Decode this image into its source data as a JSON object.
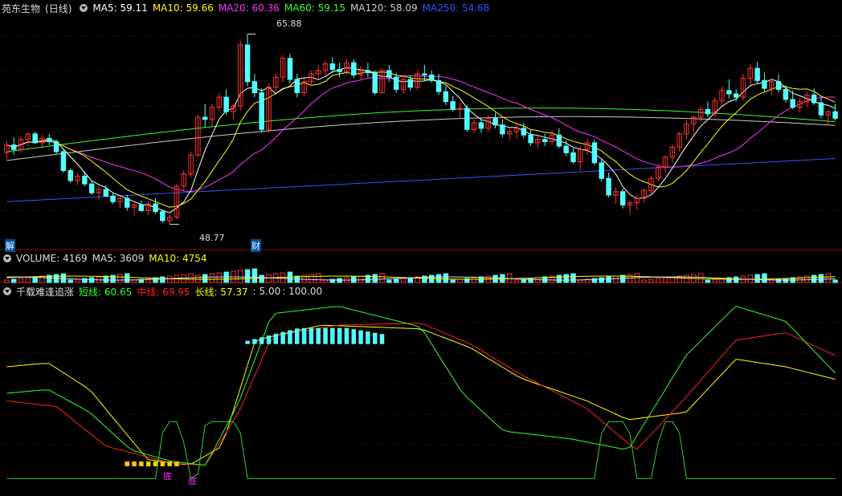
{
  "stock": {
    "name": "苑东生物",
    "period": "(日线)"
  },
  "ma_legend": [
    {
      "label": "MA5: 59.11",
      "color": "#ffffff"
    },
    {
      "label": "MA10: 59.66",
      "color": "#ffff00"
    },
    {
      "label": "MA20: 60.36",
      "color": "#ff33ff"
    },
    {
      "label": "MA60: 59.15",
      "color": "#33ff33"
    },
    {
      "label": "MA120: 58.09",
      "color": "#cccccc"
    },
    {
      "label": "MA250: 54.68",
      "color": "#3355ff"
    }
  ],
  "vol_legend": [
    {
      "label": "VOLUME: 4169",
      "color": "#dddddd"
    },
    {
      "label": "MA5: 3609",
      "color": "#dddddd"
    },
    {
      "label": "MA10: 4754",
      "color": "#ffff00"
    }
  ],
  "ind_legend": [
    {
      "label": "千载难逢追涨",
      "color": "#dddddd"
    },
    {
      "label": "短线: 60.65",
      "color": "#33ff33"
    },
    {
      "label": "中线: 69.95",
      "color": "#ff2222"
    },
    {
      "label": "长线: 57.37",
      "color": "#ffff00"
    },
    {
      "label": ": 5.00",
      "color": "#dddddd"
    },
    {
      "label": ": 100.00",
      "color": "#dddddd"
    }
  ],
  "annotations": {
    "high": "65.88",
    "low": "48.77",
    "jie": "解",
    "cai": "财",
    "di": "底"
  },
  "colors": {
    "up": "#ff3333",
    "down": "#54ffff",
    "ma5": "#ffffff",
    "ma10": "#ffff00",
    "ma20": "#ff33ff",
    "ma60": "#33ff33",
    "ma120": "#cccccc",
    "ma250": "#3355ff",
    "grid": "#7a0000"
  },
  "chart_data": {
    "type": "candlestick",
    "price_ylim": [
      47.5,
      67.5
    ],
    "candles": [
      [
        55.2,
        56.3,
        54.6,
        55.9
      ],
      [
        55.9,
        56.6,
        55.0,
        55.5
      ],
      [
        55.5,
        56.7,
        55.2,
        56.4
      ],
      [
        56.4,
        57.0,
        55.8,
        56.9
      ],
      [
        56.9,
        57.1,
        56.0,
        56.1
      ],
      [
        56.1,
        56.8,
        55.6,
        56.5
      ],
      [
        56.5,
        56.9,
        55.9,
        56.2
      ],
      [
        56.2,
        56.4,
        55.1,
        55.3
      ],
      [
        55.3,
        55.6,
        53.4,
        53.6
      ],
      [
        53.6,
        53.8,
        52.5,
        52.7
      ],
      [
        52.7,
        53.4,
        52.3,
        53.1
      ],
      [
        53.1,
        53.5,
        52.2,
        52.4
      ],
      [
        52.4,
        52.7,
        51.4,
        51.6
      ],
      [
        51.6,
        52.2,
        51.0,
        51.9
      ],
      [
        51.9,
        52.3,
        51.2,
        51.3
      ],
      [
        51.3,
        51.6,
        50.6,
        50.8
      ],
      [
        50.8,
        51.3,
        50.2,
        51.1
      ],
      [
        51.1,
        51.4,
        50.0,
        50.3
      ],
      [
        50.3,
        50.7,
        49.6,
        50.5
      ],
      [
        50.5,
        50.9,
        49.9,
        50.0
      ],
      [
        50.0,
        50.8,
        49.6,
        50.6
      ],
      [
        50.6,
        51.1,
        49.7,
        49.9
      ],
      [
        49.9,
        50.1,
        48.9,
        49.1
      ],
      [
        49.1,
        49.6,
        48.8,
        49.4
      ],
      [
        49.4,
        52.4,
        49.2,
        52.2
      ],
      [
        52.2,
        53.6,
        51.8,
        53.3
      ],
      [
        53.3,
        55.3,
        53.0,
        55.0
      ],
      [
        55.0,
        58.6,
        54.8,
        58.4
      ],
      [
        58.4,
        59.6,
        57.5,
        58.2
      ],
      [
        58.2,
        59.6,
        57.6,
        59.3
      ],
      [
        59.3,
        60.6,
        58.9,
        60.2
      ],
      [
        60.2,
        60.9,
        58.6,
        58.9
      ],
      [
        58.9,
        59.6,
        58.2,
        59.4
      ],
      [
        59.4,
        65.3,
        59.0,
        64.9
      ],
      [
        64.9,
        65.88,
        61.2,
        61.6
      ],
      [
        61.6,
        62.3,
        60.2,
        60.6
      ],
      [
        60.6,
        61.0,
        57.0,
        57.3
      ],
      [
        57.3,
        61.4,
        57.0,
        61.1
      ],
      [
        61.1,
        62.4,
        60.7,
        62.0
      ],
      [
        62.0,
        64.0,
        61.5,
        63.7
      ],
      [
        63.7,
        64.1,
        61.5,
        61.8
      ],
      [
        61.8,
        62.3,
        60.2,
        60.6
      ],
      [
        60.6,
        61.9,
        60.3,
        61.6
      ],
      [
        61.6,
        62.6,
        61.2,
        62.3
      ],
      [
        62.3,
        63.1,
        61.9,
        62.6
      ],
      [
        62.6,
        63.5,
        62.2,
        63.2
      ],
      [
        63.2,
        63.8,
        62.4,
        62.7
      ],
      [
        62.7,
        63.3,
        62.0,
        62.5
      ],
      [
        62.5,
        63.7,
        62.2,
        63.3
      ],
      [
        63.3,
        63.6,
        61.9,
        62.2
      ],
      [
        62.2,
        63.0,
        61.7,
        62.6
      ],
      [
        62.6,
        63.3,
        62.0,
        62.4
      ],
      [
        62.4,
        62.6,
        60.4,
        60.6
      ],
      [
        60.6,
        62.8,
        60.5,
        62.6
      ],
      [
        62.6,
        63.1,
        61.6,
        62.0
      ],
      [
        62.0,
        62.4,
        60.6,
        60.9
      ],
      [
        60.9,
        62.1,
        60.5,
        61.8
      ],
      [
        61.8,
        62.2,
        60.8,
        61.1
      ],
      [
        61.1,
        62.6,
        60.9,
        62.3
      ],
      [
        62.3,
        63.1,
        61.7,
        62.2
      ],
      [
        62.2,
        62.6,
        61.5,
        61.7
      ],
      [
        61.7,
        62.3,
        60.4,
        60.7
      ],
      [
        60.7,
        61.2,
        59.5,
        59.8
      ],
      [
        59.8,
        60.3,
        58.9,
        59.1
      ],
      [
        59.1,
        59.7,
        58.3,
        59.2
      ],
      [
        59.2,
        59.5,
        57.1,
        57.3
      ],
      [
        57.3,
        58.2,
        57.0,
        57.9
      ],
      [
        57.9,
        58.3,
        57.0,
        57.4
      ],
      [
        57.4,
        58.6,
        57.1,
        58.3
      ],
      [
        58.3,
        58.8,
        57.4,
        57.7
      ],
      [
        57.7,
        58.2,
        56.6,
        56.9
      ],
      [
        56.9,
        57.4,
        56.4,
        57.1
      ],
      [
        57.1,
        57.8,
        56.5,
        57.4
      ],
      [
        57.4,
        57.9,
        56.5,
        56.8
      ],
      [
        56.8,
        57.3,
        55.8,
        56.1
      ],
      [
        56.1,
        56.7,
        55.6,
        56.4
      ],
      [
        56.4,
        56.9,
        55.8,
        56.2
      ],
      [
        56.2,
        57.2,
        55.9,
        56.8
      ],
      [
        56.8,
        57.4,
        55.6,
        55.8
      ],
      [
        55.8,
        56.3,
        54.9,
        55.2
      ],
      [
        55.2,
        55.6,
        54.2,
        54.4
      ],
      [
        54.4,
        55.8,
        53.6,
        55.5
      ],
      [
        55.5,
        56.5,
        55.0,
        56.1
      ],
      [
        56.1,
        56.4,
        54.1,
        54.3
      ],
      [
        54.3,
        54.7,
        52.6,
        52.9
      ],
      [
        52.9,
        53.4,
        51.2,
        51.4
      ],
      [
        51.4,
        52.1,
        50.6,
        51.7
      ],
      [
        51.7,
        52.0,
        50.2,
        50.5
      ],
      [
        50.5,
        50.9,
        49.6,
        50.7
      ],
      [
        50.7,
        51.4,
        50.1,
        51.1
      ],
      [
        51.1,
        52.0,
        50.7,
        51.8
      ],
      [
        51.8,
        53.1,
        51.5,
        52.9
      ],
      [
        52.9,
        54.2,
        52.6,
        53.9
      ],
      [
        53.9,
        55.0,
        53.4,
        54.8
      ],
      [
        54.8,
        56.0,
        54.3,
        55.7
      ],
      [
        55.7,
        57.1,
        55.3,
        56.9
      ],
      [
        56.9,
        58.1,
        56.4,
        57.8
      ],
      [
        57.8,
        58.6,
        57.0,
        58.4
      ],
      [
        58.4,
        59.4,
        58.0,
        59.1
      ],
      [
        59.1,
        59.8,
        58.4,
        58.7
      ],
      [
        58.7,
        60.2,
        58.4,
        59.9
      ],
      [
        59.9,
        61.2,
        59.4,
        60.8
      ],
      [
        60.8,
        61.8,
        60.1,
        60.5
      ],
      [
        60.5,
        60.9,
        59.8,
        60.2
      ],
      [
        60.2,
        62.3,
        59.9,
        61.9
      ],
      [
        61.9,
        63.2,
        61.3,
        62.8
      ],
      [
        62.8,
        63.4,
        61.4,
        61.7
      ],
      [
        61.7,
        62.4,
        60.7,
        61.0
      ],
      [
        61.0,
        61.9,
        60.4,
        61.6
      ],
      [
        61.6,
        62.3,
        60.6,
        60.9
      ],
      [
        60.9,
        61.3,
        59.7,
        60.0
      ],
      [
        60.0,
        60.8,
        59.1,
        59.3
      ],
      [
        59.3,
        60.1,
        58.8,
        59.8
      ],
      [
        59.8,
        60.7,
        59.3,
        60.4
      ],
      [
        60.4,
        61.0,
        59.5,
        59.7
      ],
      [
        59.7,
        60.3,
        58.3,
        58.6
      ],
      [
        58.6,
        59.0,
        57.7,
        58.9
      ],
      [
        58.9,
        59.6,
        58.1,
        58.3
      ]
    ],
    "ma250": {
      "start": 50.8,
      "end": 54.68
    },
    "volume": {
      "values": [
        4169
      ],
      "ma5": 3609,
      "ma10": 4754
    },
    "indicator": {
      "name": "千载难逢追涨",
      "short": 60.65,
      "mid": 69.95,
      "long": 57.37,
      "ref_levels": [
        5.0,
        100.0
      ],
      "ylim": [
        0,
        100
      ]
    }
  }
}
